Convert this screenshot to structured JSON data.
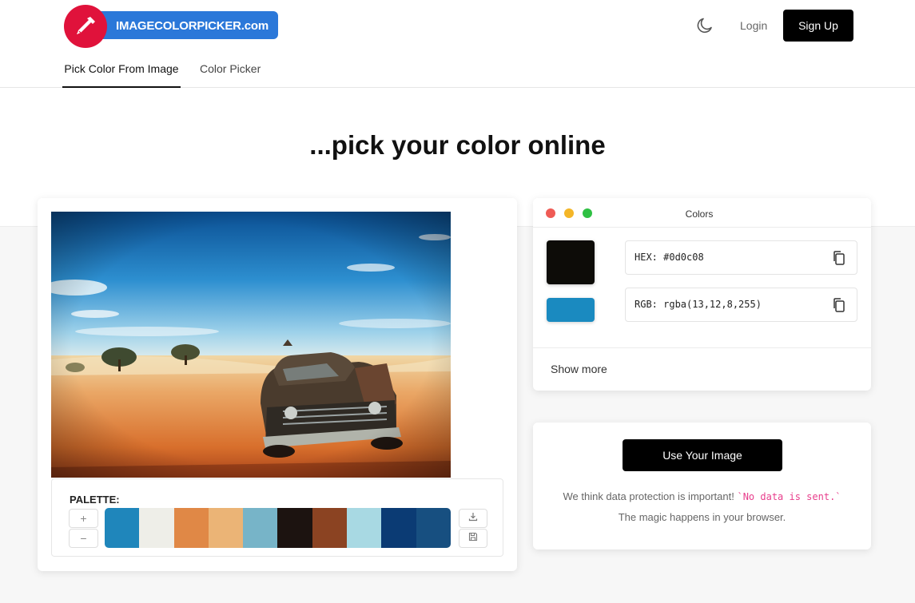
{
  "header": {
    "logo_text": "IMAGECOLORPICKER.com",
    "login_label": "Login",
    "signup_label": "Sign Up",
    "theme_icon": "moon-icon"
  },
  "tabs": [
    {
      "label": "Pick Color From Image",
      "active": true
    },
    {
      "label": "Color Picker",
      "active": false
    }
  ],
  "hero": {
    "title": "...pick your color online"
  },
  "palette": {
    "label": "PALETTE:",
    "zoom_in": "+",
    "zoom_out": "−",
    "swatches": [
      "#1f86bb",
      "#eeeee8",
      "#e08846",
      "#ebb476",
      "#77b4c8",
      "#1c1310",
      "#8b4322",
      "#a8d9e3",
      "#0b3b74",
      "#174f80"
    ],
    "download_icon": "download-icon",
    "save_icon": "save-icon"
  },
  "colors_panel": {
    "title": "Colors",
    "selected_color": "#0d0c08",
    "secondary_color": "#1a8ac0",
    "hex_text": "HEX: #0d0c08",
    "rgb_text": "RGB: rgba(13,12,8,255)",
    "show_more": "Show more"
  },
  "upload": {
    "button_label": "Use Your Image",
    "privacy_text_1": "We think data protection is important! ",
    "privacy_code": "`No data is sent.`",
    "privacy_text_2": " The magic happens in your browser."
  }
}
